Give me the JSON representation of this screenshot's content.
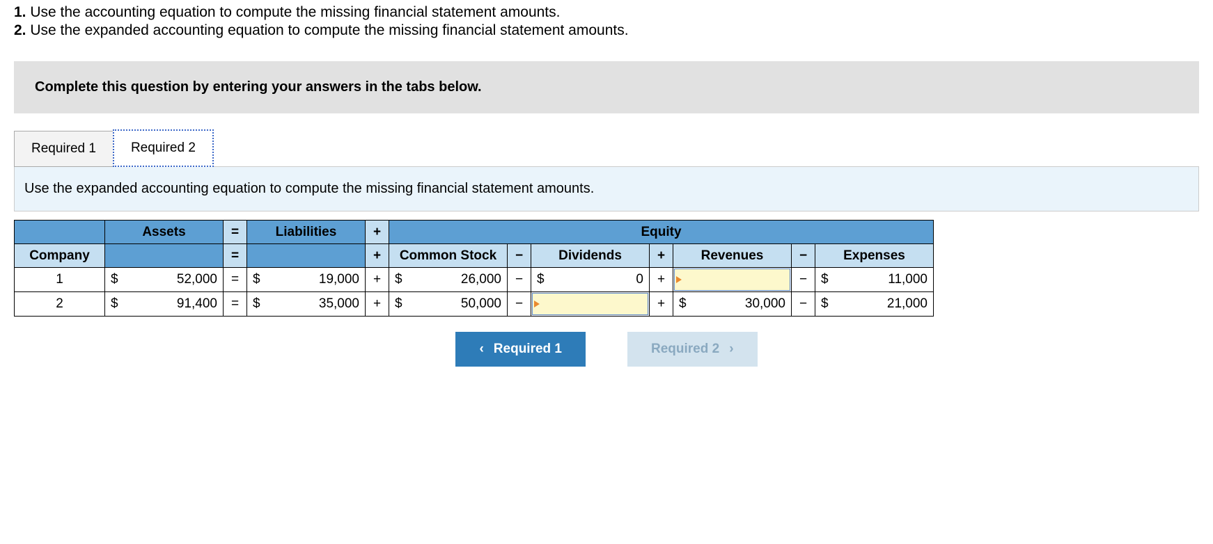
{
  "instructions": {
    "line1_num": "1.",
    "line1_text": "Use the accounting equation to compute the missing financial statement amounts.",
    "line2_num": "2.",
    "line2_text": "Use the expanded accounting equation to compute the missing financial statement amounts."
  },
  "box_text": "Complete this question by entering your answers in the tabs below.",
  "tabs": {
    "t1": "Required 1",
    "t2": "Required 2"
  },
  "panel_text": "Use the expanded accounting equation to compute the missing financial statement amounts.",
  "headers": {
    "assets": "Assets",
    "liabilities": "Liabilities",
    "equity": "Equity",
    "company": "Company",
    "common_stock": "Common Stock",
    "dividends": "Dividends",
    "revenues": "Revenues",
    "expenses": "Expenses"
  },
  "ops": {
    "eq": "=",
    "plus": "+",
    "minus": "−"
  },
  "cur": "$",
  "rows": [
    {
      "company": "1",
      "assets": "52,000",
      "liabilities": "19,000",
      "common_stock": "26,000",
      "dividends": "0",
      "revenues": "",
      "expenses": "11,000"
    },
    {
      "company": "2",
      "assets": "91,400",
      "liabilities": "35,000",
      "common_stock": "50,000",
      "dividends": "",
      "revenues": "30,000",
      "expenses": "21,000"
    }
  ],
  "nav": {
    "prev_icon": "‹",
    "prev": "Required 1",
    "next": "Required 2",
    "next_icon": "›"
  }
}
